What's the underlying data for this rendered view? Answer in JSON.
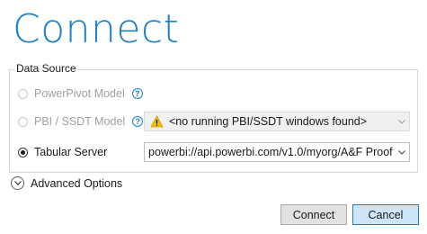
{
  "dialog": {
    "title": "Connect"
  },
  "data_source": {
    "legend": "Data Source",
    "options": [
      {
        "label": "PowerPivot Model",
        "selected": false,
        "enabled": false,
        "has_help": true
      },
      {
        "label": "PBI / SSDT Model",
        "selected": false,
        "enabled": false,
        "has_help": true,
        "combo_value": "<no running PBI/SSDT windows found>",
        "combo_icon": "warning-icon"
      },
      {
        "label": "Tabular Server",
        "selected": true,
        "enabled": true,
        "combo_value": "powerbi://api.powerbi.com/v1.0/myorg/A&F Proof"
      }
    ]
  },
  "advanced": {
    "label": "Advanced Options"
  },
  "buttons": {
    "connect": "Connect",
    "cancel": "Cancel"
  },
  "colors": {
    "accent": "#1e7fc8",
    "primary_button": "#cde6f7",
    "warning": "#f2c200"
  }
}
